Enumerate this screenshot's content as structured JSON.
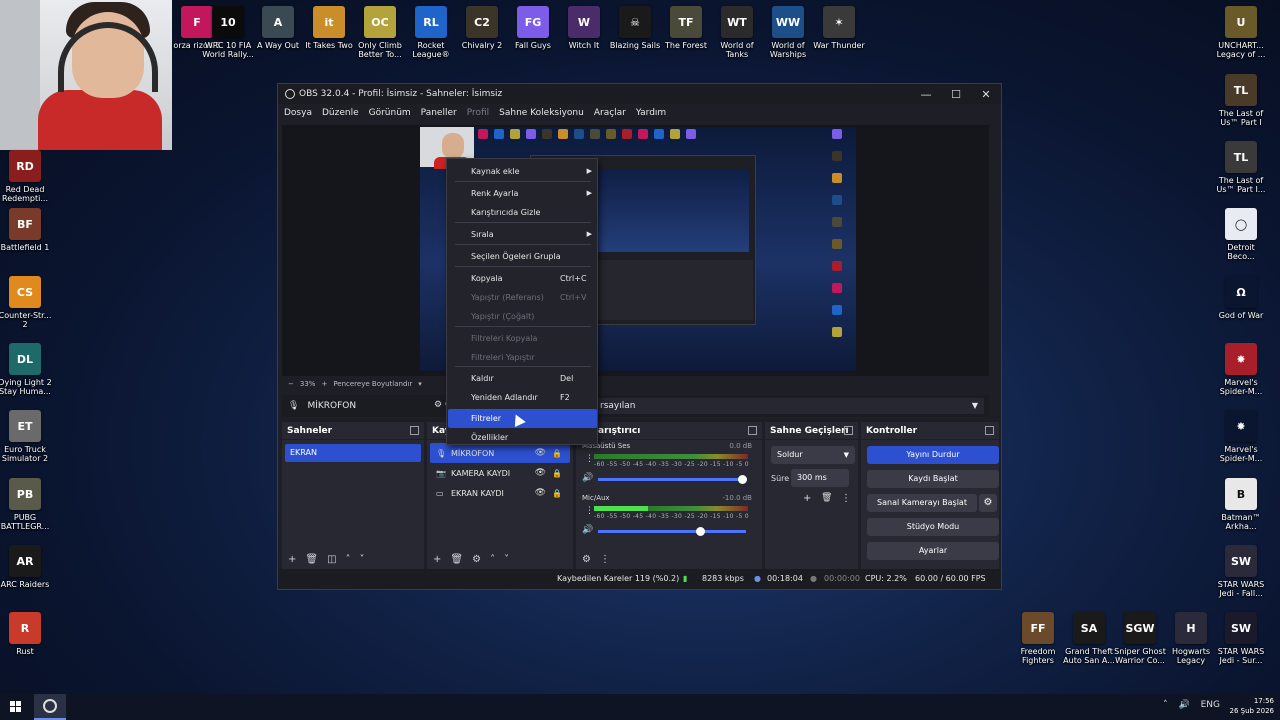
{
  "desktop": {
    "top_icons": [
      {
        "label": "orza\nrizon 5",
        "color": "#c2185b",
        "glyph": "F"
      },
      {
        "label": "WRC 10 FIA World Rally...",
        "color": "#0b0b0b",
        "glyph": "10"
      },
      {
        "label": "A Way Out",
        "color": "#3b4a52",
        "glyph": "A"
      },
      {
        "label": "It Takes Two",
        "color": "#c98e2a",
        "glyph": "it"
      },
      {
        "label": "Only Climb Better To...",
        "color": "#b3a33a",
        "glyph": "OC"
      },
      {
        "label": "Rocket League®",
        "color": "#1f64c8",
        "glyph": "RL"
      },
      {
        "label": "Chivalry 2",
        "color": "#3a3528",
        "glyph": "C2"
      },
      {
        "label": "Fall Guys",
        "color": "#7d5ce8",
        "glyph": "FG"
      },
      {
        "label": "Witch It",
        "color": "#4a2c6a",
        "glyph": "W"
      },
      {
        "label": "Blazing Sails",
        "color": "#1a1a1a",
        "glyph": "☠"
      },
      {
        "label": "The Forest",
        "color": "#4a4a3a",
        "glyph": "TF"
      },
      {
        "label": "World of Tanks",
        "color": "#2b2b2b",
        "glyph": "WT"
      },
      {
        "label": "World of Warships",
        "color": "#1c4e8a",
        "glyph": "WW"
      },
      {
        "label": "War Thunder",
        "color": "#3a3a3a",
        "glyph": "✶"
      }
    ],
    "left_icons": [
      {
        "label": "Red Dead Redempti...",
        "color": "#8a1e1e",
        "glyph": "RD"
      },
      {
        "label": "Battlefield 1",
        "color": "#7a3a2a",
        "glyph": "BF"
      },
      {
        "label": "Counter-Str... 2",
        "color": "#e08a1e",
        "glyph": "CS"
      },
      {
        "label": "Dying Light 2 Stay Huma...",
        "color": "#1e6a6a",
        "glyph": "DL"
      },
      {
        "label": "Euro Truck Simulator 2",
        "color": "#6a6a6a",
        "glyph": "ET"
      },
      {
        "label": "PUBG BATTLEGR...",
        "color": "#5a5a4a",
        "glyph": "PB"
      },
      {
        "label": "ARC Raiders",
        "color": "#1a1a1a",
        "glyph": "AR"
      },
      {
        "label": "Rust",
        "color": "#c83a2a",
        "glyph": "R"
      }
    ],
    "right_icons": [
      {
        "label": "UNCHART... Legacy of ...",
        "color": "#6a5a2a",
        "glyph": "U"
      },
      {
        "label": "The Last of Us™ Part I",
        "color": "#4a3a2a",
        "glyph": "TL"
      },
      {
        "label": "The Last of Us™ Part I...",
        "color": "#3a3a3a",
        "glyph": "TL"
      },
      {
        "label": "Detroit Beco...",
        "color": "#e8ecf2",
        "glyph": "◯"
      },
      {
        "label": "God of War",
        "color": "#0a1530",
        "glyph": "Ω"
      },
      {
        "label": "Marvel's Spider-M...",
        "color": "#a81e2a",
        "glyph": "✸"
      },
      {
        "label": "Marvel's Spider-M...",
        "color": "#0a1530",
        "glyph": "✸"
      },
      {
        "label": "Batman™ Arkha...",
        "color": "#e8e8e8",
        "glyph": "B"
      },
      {
        "label": "STAR WARS Jedi - Fall...",
        "color": "#2a2a3a",
        "glyph": "SW"
      },
      {
        "label": "STAR WARS Jedi - Sur...",
        "color": "#1a1a2a",
        "glyph": "SW"
      }
    ],
    "bottom_icons": [
      {
        "label": "Freedom Fighters",
        "color": "#6a4a2a",
        "glyph": "FF"
      },
      {
        "label": "Grand Theft Auto San A...",
        "color": "#1a1a1a",
        "glyph": "SA"
      },
      {
        "label": "Sniper Ghost Warrior Co...",
        "color": "#1a1a1a",
        "glyph": "SGW"
      },
      {
        "label": "Hogwarts Legacy",
        "color": "#2a2a3a",
        "glyph": "H"
      }
    ]
  },
  "obs": {
    "title": "OBS 32.0.4 - Profil: İsimsiz - Sahneler: İsimsiz",
    "window_controls": {
      "minimize": "—",
      "maximize": "☐",
      "close": "✕"
    },
    "menu": [
      "Dosya",
      "Düzenle",
      "Görünüm",
      "Paneller",
      "Profil",
      "Sahne Koleksiyonu",
      "Araçlar",
      "Yardım"
    ],
    "preview_toolbar": {
      "zoom_minus": "−",
      "zoom": "33%",
      "zoom_plus": "+",
      "fit": "Pencereye Boyutlandır",
      "fit_caret": "▾"
    },
    "source_bar": {
      "mic_icon": "microphone-icon",
      "source_name": "MİKROFON",
      "profile_text": "rsayılan",
      "gear_text": "Ö"
    },
    "scenes": {
      "title": "Sahneler",
      "items": [
        "EKRAN"
      ],
      "footer": [
        "+",
        "🗑",
        "◫",
        "˄",
        "˅"
      ]
    },
    "sources": {
      "title": "Kay",
      "items": [
        {
          "name": "MİKROFON",
          "icon": "🎙",
          "selected": true
        },
        {
          "name": "KAMERA KAYDI",
          "icon": "📷",
          "selected": false
        },
        {
          "name": "EKRAN KAYDI",
          "icon": "▭",
          "selected": false
        }
      ],
      "footer": [
        "+",
        "🗑",
        "⚙",
        "˄",
        "˅"
      ]
    },
    "mixer": {
      "title": "Karıştırıcı",
      "title_visible": "arıştırıcı",
      "channels": [
        {
          "name": "Masaüstü Ses",
          "db": "0.0 dB",
          "level": 0.0,
          "volume": 1.0
        },
        {
          "name": "Mic/Aux",
          "db": "-10.0 dB",
          "level": 0.35,
          "volume": 0.7
        }
      ],
      "ticks": "-60 -55 -50 -45 -40 -35 -30 -25 -20 -15 -10 -5 0",
      "footer": [
        "⚙",
        "⋮"
      ]
    },
    "transitions": {
      "title": "Sahne Geçişleri",
      "selected": "Soldur",
      "duration_label": "Süre",
      "duration_value": "300 ms",
      "buttons": [
        "+",
        "🗑",
        "⋮"
      ]
    },
    "controls": {
      "title": "Kontroller",
      "buttons": [
        "Yayını Durdur",
        "Kaydı Başlat",
        "Sanal Kamerayı Başlat",
        "Stüdyo Modu",
        "Ayarlar"
      ],
      "gear": "⚙"
    },
    "status": {
      "dropped": "Kaybedilen Kareler 119 (%0.2)",
      "bitrate": "8283 kbps",
      "stream_time": "00:18:04",
      "rec_time": "00:00:00",
      "cpu": "CPU: 2.2%",
      "fps": "60.00 / 60.00 FPS"
    }
  },
  "context_menu": {
    "items": [
      {
        "label": "Kaynak ekle",
        "shortcut": "",
        "submenu": true,
        "disabled": false,
        "highlighted": false
      },
      {
        "label": "Renk Ayarla",
        "shortcut": "",
        "submenu": true,
        "disabled": false,
        "highlighted": false
      },
      {
        "label": "Karıştırıcıda Gizle",
        "shortcut": "",
        "submenu": false,
        "disabled": false,
        "highlighted": false
      },
      {
        "label": "Sırala",
        "shortcut": "",
        "submenu": true,
        "disabled": false,
        "highlighted": false
      },
      {
        "label": "Seçilen Ögeleri Grupla",
        "shortcut": "",
        "submenu": false,
        "disabled": false,
        "highlighted": false
      },
      {
        "label": "Kopyala",
        "shortcut": "Ctrl+C",
        "submenu": false,
        "disabled": false,
        "highlighted": false
      },
      {
        "label": "Yapıştır (Referans)",
        "shortcut": "Ctrl+V",
        "submenu": false,
        "disabled": true,
        "highlighted": false
      },
      {
        "label": "Yapıştır (Çoğalt)",
        "shortcut": "",
        "submenu": false,
        "disabled": true,
        "highlighted": false
      },
      {
        "label": "Filtreleri Kopyala",
        "shortcut": "",
        "submenu": false,
        "disabled": true,
        "highlighted": false
      },
      {
        "label": "Filtreleri Yapıştır",
        "shortcut": "",
        "submenu": false,
        "disabled": true,
        "highlighted": false
      },
      {
        "label": "Kaldır",
        "shortcut": "Del",
        "submenu": false,
        "disabled": false,
        "highlighted": false
      },
      {
        "label": "Yeniden Adlandır",
        "shortcut": "F2",
        "submenu": false,
        "disabled": false,
        "highlighted": false
      },
      {
        "label": "Filtreler",
        "shortcut": "",
        "submenu": false,
        "disabled": false,
        "highlighted": true
      },
      {
        "label": "Özellikler",
        "shortcut": "",
        "submenu": false,
        "disabled": false,
        "highlighted": false
      }
    ]
  },
  "taskbar": {
    "tray": [
      "˄",
      "🔊",
      "ENG"
    ],
    "time": "17:56",
    "date": "26 Şub 2026"
  },
  "colors": {
    "accent": "#2c50d0",
    "obs_bg": "#1e1f26",
    "dock_bg": "#272831"
  }
}
